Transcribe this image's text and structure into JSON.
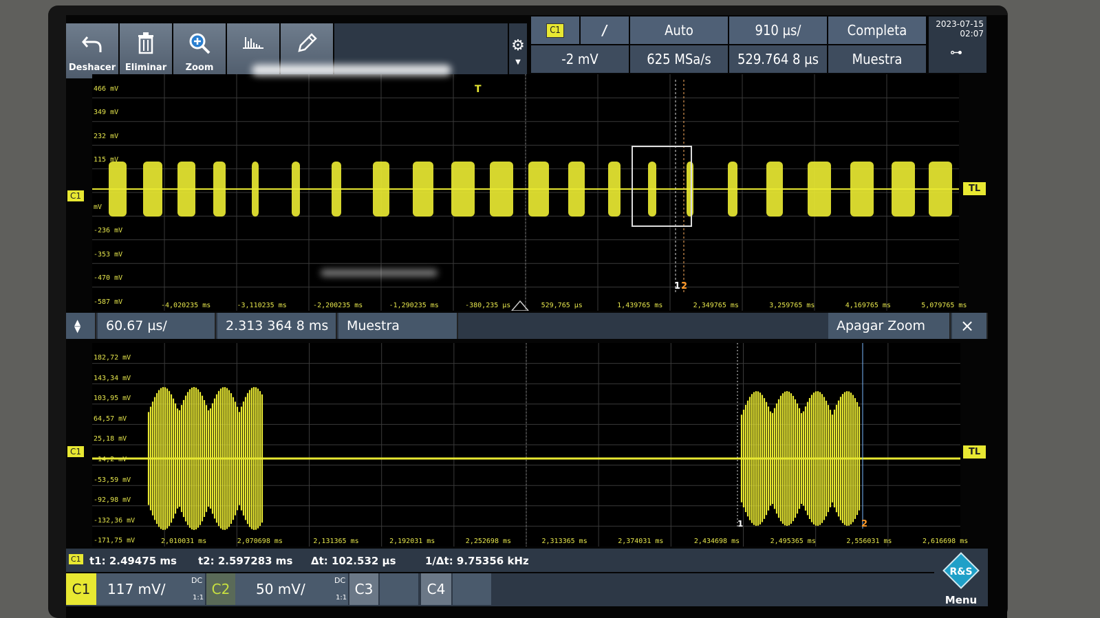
{
  "toolbar": {
    "buttons": [
      {
        "label": "Deshacer",
        "icon": "undo-icon"
      },
      {
        "label": "Eliminar",
        "icon": "trash-icon"
      },
      {
        "label": "Zoom",
        "icon": "zoom-icon"
      },
      {
        "label": "",
        "icon": "histogram-icon"
      },
      {
        "label": "",
        "icon": "pencil-icon"
      }
    ]
  },
  "trigger": {
    "source": "C1",
    "slope": "/",
    "mode": "Auto",
    "level": "-2 mV",
    "sample_rate": "625 MSa/s"
  },
  "timebase": {
    "scale": "910 µs/",
    "position": "529.764 8 µs"
  },
  "acquisition": {
    "record": "Completa",
    "type": "Muestra"
  },
  "datetime": {
    "date": "2023-07-15",
    "time": "02:07"
  },
  "main_plot": {
    "y_ticks": [
      "466 mV",
      "349 mV",
      "232 mV",
      "115 mV",
      "",
      "mV",
      "-236 mV",
      "-353 mV",
      "-470 mV",
      "-587 mV"
    ],
    "x_ticks": [
      "-4,020235 ms",
      "-3,110235 ms",
      "-2,200235 ms",
      "-1,290235 ms",
      "-380,235 µs",
      "529,765 µs",
      "1,439765 ms",
      "2,349765 ms",
      "3,259765 ms",
      "4,169765 ms",
      "5,079765 ms"
    ],
    "channel_label": "C1",
    "trigger_level_label": "TL",
    "trigger_marker": "T",
    "cursor1_label": "1",
    "cursor2_label": "2"
  },
  "zoom_bar": {
    "scale": "60.67 µs/",
    "position": "2.313 364 8 ms",
    "type": "Muestra",
    "off_label": "Apagar Zoom",
    "close": "×"
  },
  "zoom_plot": {
    "y_ticks": [
      "182,72 mV",
      "143,34 mV",
      "103,95 mV",
      "64,57 mV",
      "25,18 mV",
      "-14,2 mV",
      "-53,59 mV",
      "-92,98 mV",
      "-132,36 mV",
      "-171,75 mV"
    ],
    "x_ticks": [
      "2,010031 ms",
      "2,070698 ms",
      "2,131365 ms",
      "2,192031 ms",
      "2,252698 ms",
      "2,313365 ms",
      "2,374031 ms",
      "2,434698 ms",
      "2,495365 ms",
      "2,556031 ms",
      "2,616698 ms"
    ],
    "channel_label": "C1",
    "trigger_level_label": "TL",
    "cursor1_label": "1",
    "cursor2_label": "2"
  },
  "measurements": {
    "source": "C1",
    "t1": "t1: 2.49475 ms",
    "t2": "t2: 2.597283 ms",
    "dt": "Δt: 102.532 µs",
    "inv_dt": "1/Δt: 9.75356 kHz"
  },
  "channels": [
    {
      "name": "C1",
      "scale": "117 mV/",
      "coupling": "DC",
      "ratio": "1:1"
    },
    {
      "name": "C2",
      "scale": "50 mV/",
      "coupling": "DC",
      "ratio": "1:1"
    },
    {
      "name": "C3"
    },
    {
      "name": "C4"
    }
  ],
  "menu": {
    "logo": "R&S",
    "label": "Menu"
  },
  "colors": {
    "trace": "#e8e832",
    "panel": "#4f6076",
    "accent": "#1fa0c8"
  }
}
